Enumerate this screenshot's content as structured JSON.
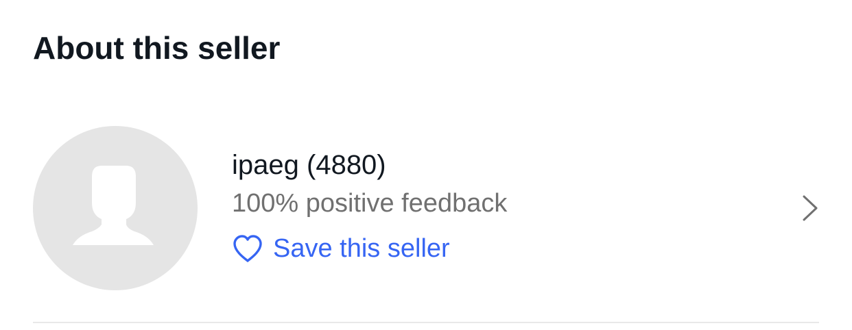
{
  "section": {
    "title": "About this seller"
  },
  "seller": {
    "avatar_icon": "default-user-silhouette-icon",
    "name": "ipaeg",
    "feedback_score": "(4880)",
    "feedback_text": "100% positive feedback",
    "save_label": "Save this seller",
    "save_icon": "heart-outline-icon",
    "chevron_icon": "chevron-right-icon"
  },
  "colors": {
    "title_text": "#111820",
    "secondary_text": "#707070",
    "link_blue": "#3665f3",
    "avatar_bg": "#e5e5e5",
    "divider": "#e8e8e8"
  }
}
